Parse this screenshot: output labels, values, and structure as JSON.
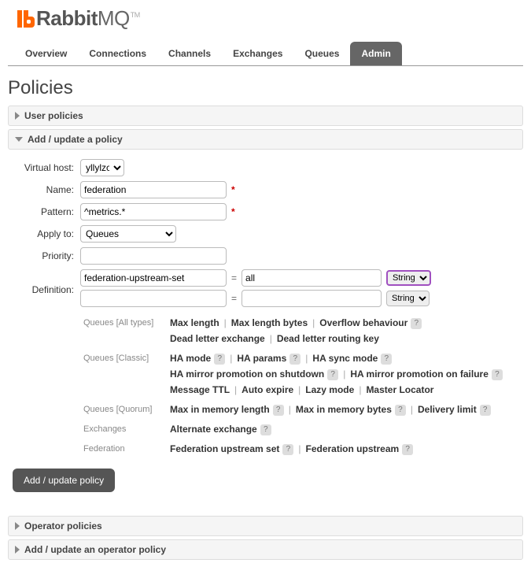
{
  "logo": {
    "strong": "Rabbit",
    "rest": "MQ",
    "tm": "TM"
  },
  "tabs": [
    {
      "label": "Overview"
    },
    {
      "label": "Connections"
    },
    {
      "label": "Channels"
    },
    {
      "label": "Exchanges"
    },
    {
      "label": "Queues"
    },
    {
      "label": "Admin"
    }
  ],
  "active_tab": "Admin",
  "page_title": "Policies",
  "sections": {
    "user_policies": "User policies",
    "add_update": "Add / update a policy",
    "operator_policies": "Operator policies",
    "add_operator": "Add / update an operator policy"
  },
  "form": {
    "vhost_label": "Virtual host:",
    "vhost_value": "yllylzch",
    "name_label": "Name:",
    "name_value": "federation",
    "pattern_label": "Pattern:",
    "pattern_value": "^metrics.*",
    "apply_label": "Apply to:",
    "apply_value": "Queues",
    "priority_label": "Priority:",
    "priority_value": "",
    "definition_label": "Definition:",
    "def1_key": "federation-upstream-set",
    "def1_val": "all",
    "def1_type": "String",
    "def2_key": "",
    "def2_val": "",
    "def2_type": "String"
  },
  "hints": {
    "groups": [
      {
        "label": "Queues [All types]",
        "items": [
          {
            "t": "Max length"
          },
          {
            "t": "Max length bytes"
          },
          {
            "t": "Overflow behaviour",
            "h": true
          },
          {
            "br": true
          },
          {
            "t": "Dead letter exchange"
          },
          {
            "t": "Dead letter routing key"
          }
        ]
      },
      {
        "label": "Queues [Classic]",
        "items": [
          {
            "t": "HA mode",
            "h": true
          },
          {
            "t": "HA params",
            "h": true
          },
          {
            "t": "HA sync mode",
            "h": true
          },
          {
            "br": true
          },
          {
            "t": "HA mirror promotion on shutdown",
            "h": true
          },
          {
            "t": "HA mirror promotion on failure",
            "h": true
          },
          {
            "br": true
          },
          {
            "t": "Message TTL"
          },
          {
            "t": "Auto expire"
          },
          {
            "t": "Lazy mode"
          },
          {
            "t": "Master Locator"
          }
        ]
      },
      {
        "label": "Queues [Quorum]",
        "items": [
          {
            "t": "Max in memory length",
            "h": true
          },
          {
            "t": "Max in memory bytes",
            "h": true
          },
          {
            "t": "Delivery limit",
            "h": true
          }
        ]
      },
      {
        "label": "Exchanges",
        "items": [
          {
            "t": "Alternate exchange",
            "h": true
          }
        ]
      },
      {
        "label": "Federation",
        "items": [
          {
            "t": "Federation upstream set",
            "h": true
          },
          {
            "t": "Federation upstream",
            "h": true
          }
        ]
      }
    ]
  },
  "submit_label": "Add / update policy"
}
